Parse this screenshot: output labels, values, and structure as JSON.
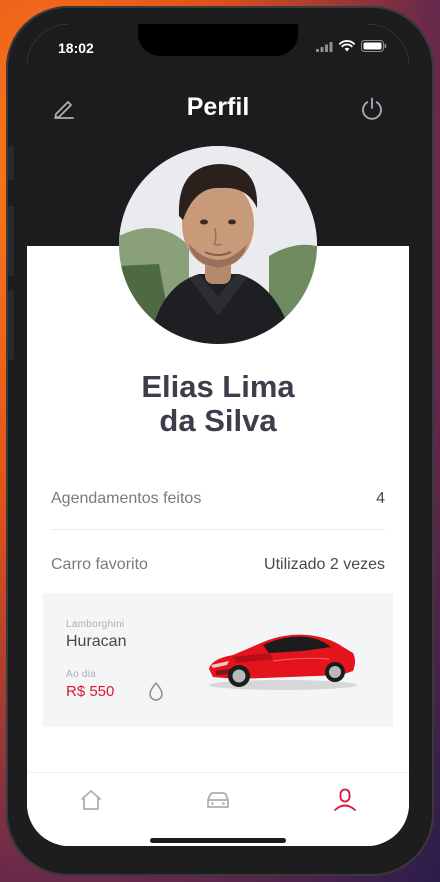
{
  "status_bar": {
    "time": "18:02",
    "icons": [
      "signal-icon",
      "wifi-icon",
      "battery-icon"
    ]
  },
  "header": {
    "title": "Perfil",
    "left_icon": "edit-icon",
    "right_icon": "power-icon"
  },
  "profile": {
    "name_line1": "Elias Lima",
    "name_line2": "da Silva"
  },
  "stats": {
    "appointments_label": "Agendamentos feitos",
    "appointments_value": "4",
    "favorite_label": "Carro favorito",
    "favorite_value": "Utilizado 2 vezes"
  },
  "favorite_car": {
    "brand": "Lamborghini",
    "model": "Huracan",
    "period": "Ao dia",
    "price": "R$ 550",
    "fuel_icon": "drop-icon"
  },
  "tab_bar": {
    "tabs": [
      {
        "name": "home",
        "icon": "home-icon",
        "active": false
      },
      {
        "name": "cars",
        "icon": "car-icon",
        "active": false
      },
      {
        "name": "profile",
        "icon": "profile-icon",
        "active": true
      }
    ]
  },
  "colors": {
    "header_bg": "#1c1c1e",
    "accent": "#dc1637",
    "text_primary": "#47474d",
    "text_muted": "#7a7a80",
    "card_bg": "#f4f5f6",
    "icon_inactive": "#aeaeb3"
  }
}
